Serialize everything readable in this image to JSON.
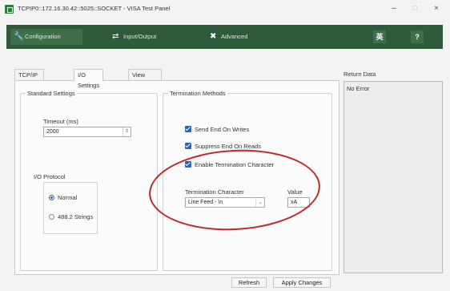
{
  "window": {
    "title": "TCPIP0::172.16.30.42::5025::SOCKET - VISA Test Panel",
    "minimize": "–",
    "maximize": "□",
    "close": "×"
  },
  "toolbar": {
    "configuration": "Configuration",
    "input_output": "Input/Output",
    "advanced": "Advanced",
    "language_glyph": "英",
    "help_glyph": "?"
  },
  "tabs": [
    {
      "label": "TCP/IP Settings"
    },
    {
      "label": "I/O Settings"
    },
    {
      "label": "View Attributes"
    }
  ],
  "standard_settings": {
    "title": "Standard Settings",
    "timeout_label": "Timeout (ms)",
    "timeout_value": "2000",
    "io_protocol_label": "I/O Protocol",
    "normal_label": "Normal",
    "strings_label": "488.2 Strings"
  },
  "termination": {
    "title": "Termination Methods",
    "send_end": "Send End On Writes",
    "suppress_end": "Suppress End On Reads",
    "enable_term": "Enable Termination Character",
    "term_char_label": "Termination Character",
    "term_char_value": "Line Feed - \\n",
    "value_label": "Value",
    "value_value": "xA"
  },
  "return_data": {
    "label": "Return Data",
    "text": "No Error"
  },
  "buttons": {
    "refresh": "Refresh",
    "apply": "Apply Changes"
  },
  "colors": {
    "toolbar_bg": "#2d5b39",
    "checkbox": "#2a64b7",
    "highlight_ellipse": "#c0282a"
  }
}
